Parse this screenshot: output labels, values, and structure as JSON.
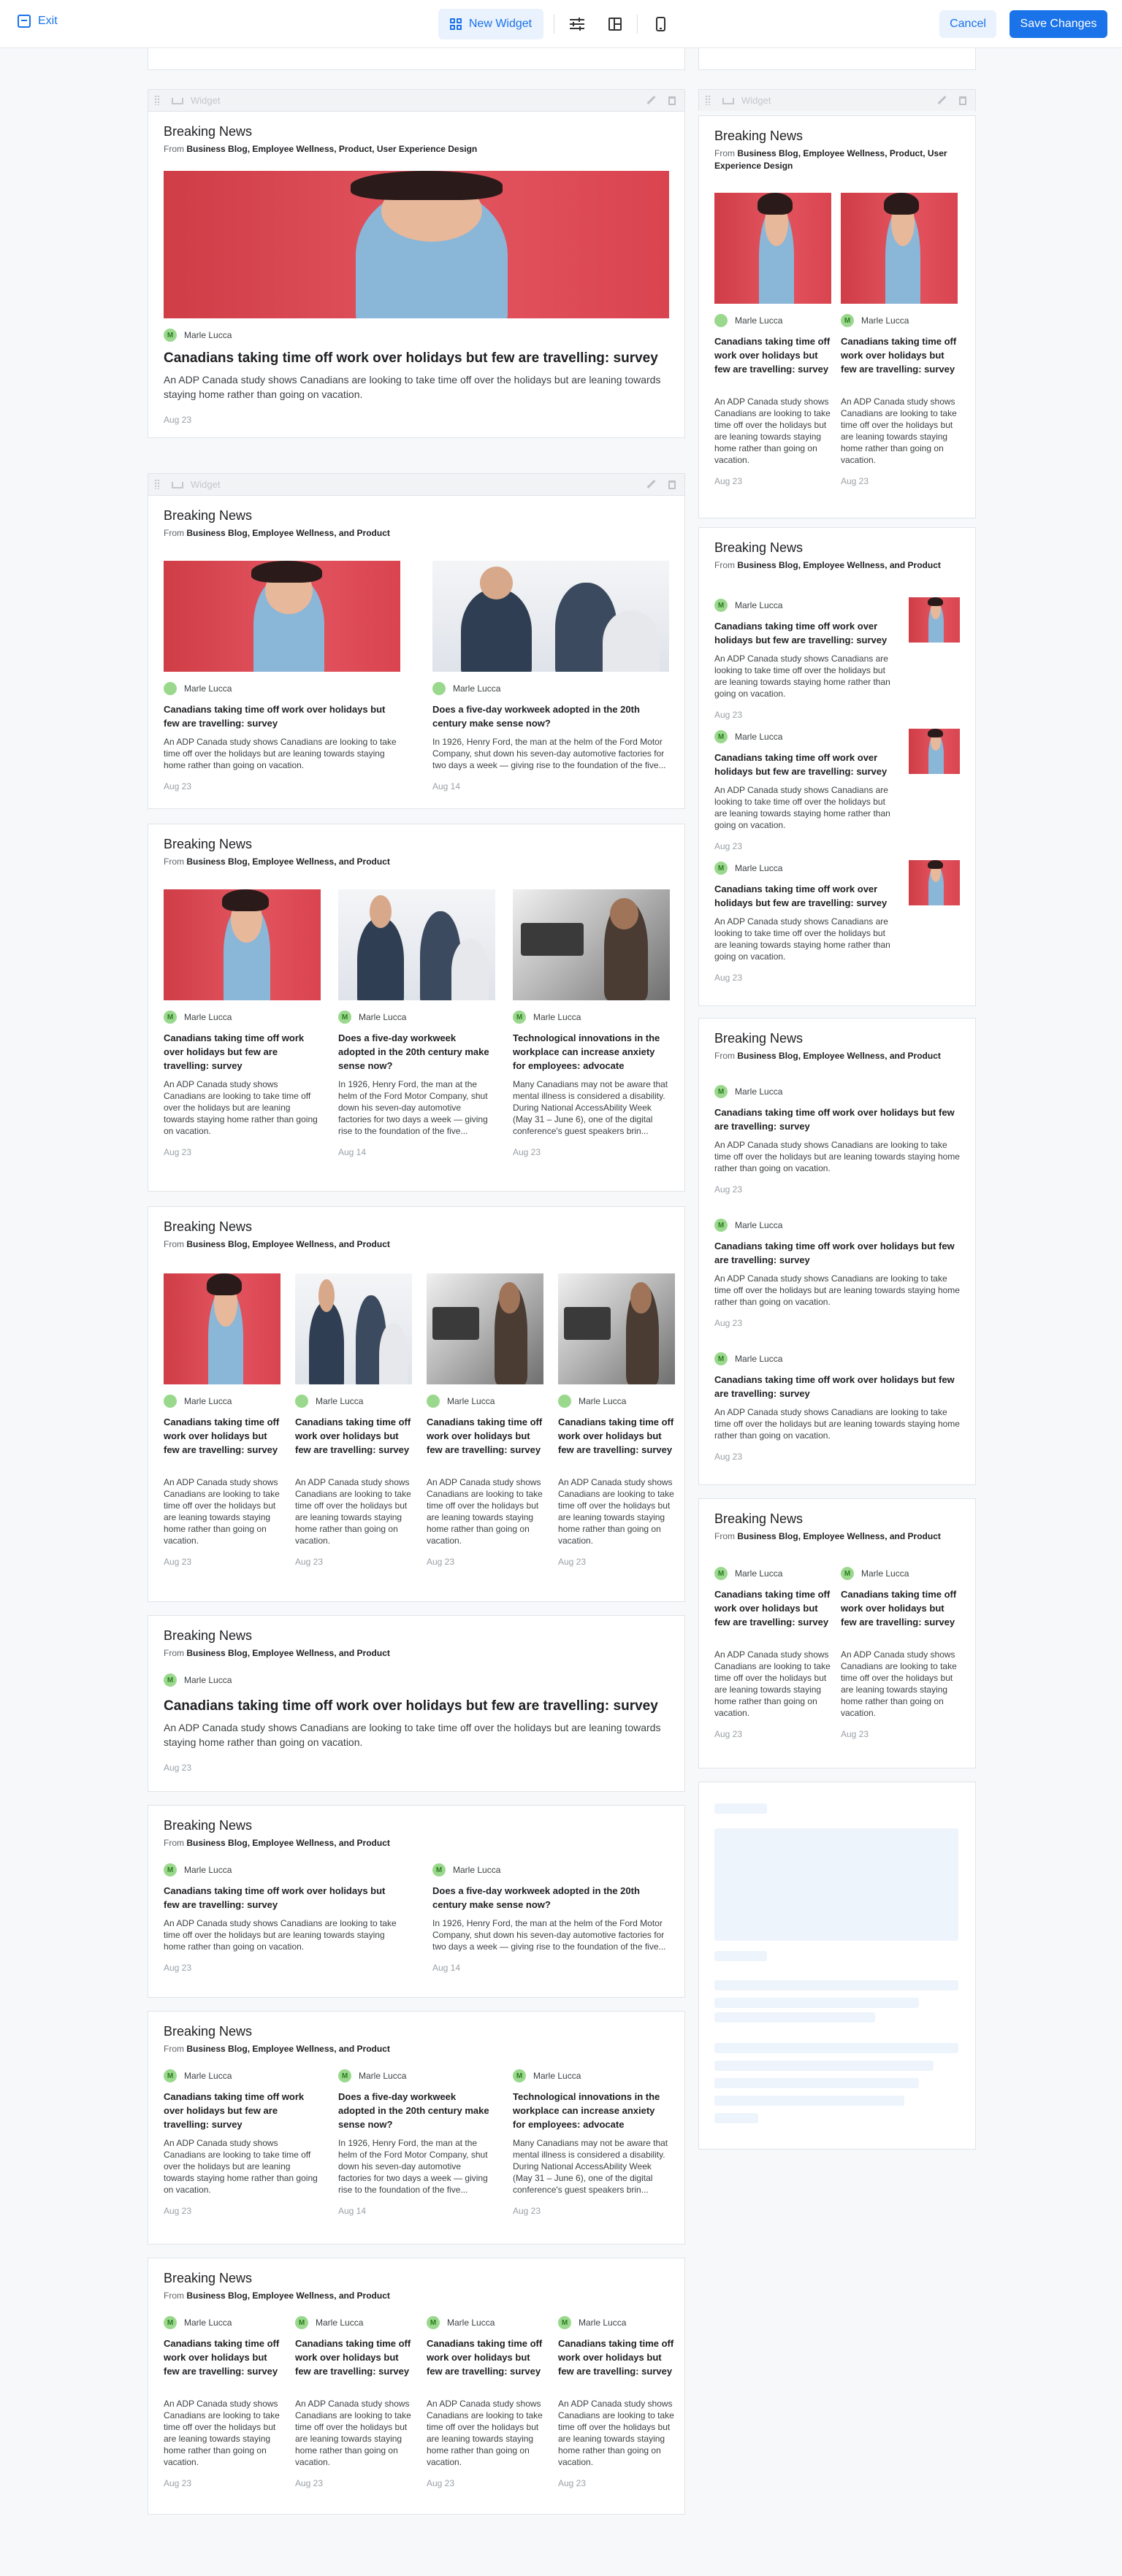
{
  "toolbar": {
    "exit_label": "Exit",
    "new_widget_label": "New Widget",
    "cancel_label": "Cancel",
    "save_label": "Save Changes"
  },
  "widget": {
    "bar_label": "Widget",
    "title": "Breaking News",
    "from_prefix": "From",
    "sources_long": "Business Blog, Employee Wellness, Product, User Experience Design",
    "sources_short": "Business Blog, Employee Wellness, and Product"
  },
  "author": {
    "name": "Marle Lucca",
    "initial": "M"
  },
  "articles": {
    "a1": {
      "title": "Canadians taking time off work over holidays but few are travelling: survey",
      "desc": "An ADP Canada study shows Canadians are looking to take time off over the holidays but are leaning towards staying home rather than going on vacation.",
      "date": "Aug 23"
    },
    "a2": {
      "title": "Does a five-day workweek adopted in the 20th century make sense now?",
      "desc": "In 1926, Henry Ford, the man at the helm of the Ford Motor Company, shut down his seven-day automotive factories for two days a week — giving rise to the foundation of the five...",
      "date": "Aug 14"
    },
    "a3": {
      "title": "Technological innovations in the workplace can increase anxiety for employees: advocate",
      "desc": "Many Canadians may not be aware that mental illness is considered a disability. During National AccessAbility Week (May 31 – June 6), one of the digital conference's guest speakers brin...",
      "date": "Aug 23"
    }
  },
  "colors": {
    "accent": "#1a73e8",
    "avatar": "#9ad98d",
    "skeleton": "#eef4fc"
  }
}
